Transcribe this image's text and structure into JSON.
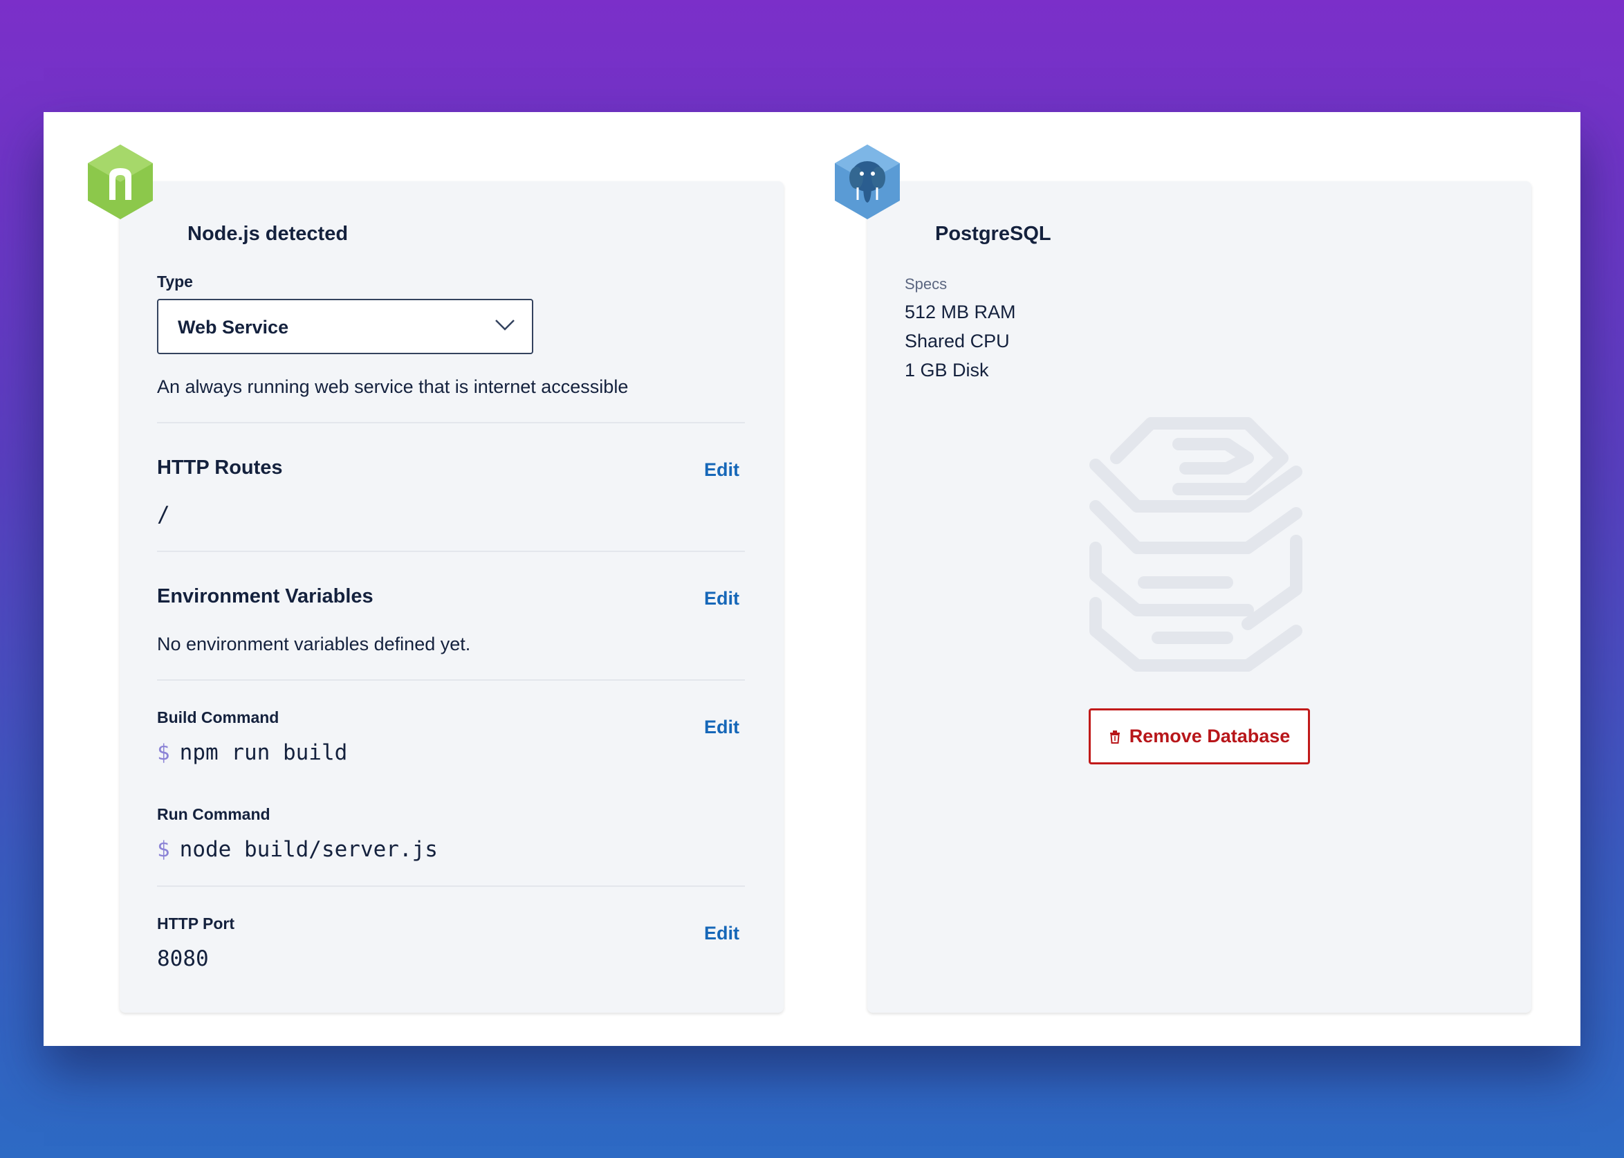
{
  "service": {
    "title": "Node.js detected",
    "type_label": "Type",
    "type_value": "Web Service",
    "type_description": "An always running web service that is internet accessible",
    "http_routes": {
      "title": "HTTP Routes",
      "edit": "Edit",
      "value": "/"
    },
    "env_vars": {
      "title": "Environment Variables",
      "edit": "Edit",
      "value": "No environment variables defined yet."
    },
    "build_command": {
      "label": "Build Command",
      "edit": "Edit",
      "prompt": "$",
      "value": "npm run build"
    },
    "run_command": {
      "label": "Run Command",
      "prompt": "$",
      "value": "node build/server.js"
    },
    "http_port": {
      "label": "HTTP Port",
      "edit": "Edit",
      "value": "8080"
    },
    "icon": "nodejs-icon",
    "icon_color": "#8cc84b"
  },
  "database": {
    "title": "PostgreSQL",
    "specs_label": "Specs",
    "specs": [
      "512 MB RAM",
      "Shared CPU",
      "1 GB Disk"
    ],
    "remove_button": "Remove Database",
    "icon": "postgresql-icon",
    "icon_color": "#336791",
    "remove_color": "#c11a1a"
  },
  "colors": {
    "link": "#1667b8",
    "background_top": "#7b2fc9",
    "background_bottom": "#2d6ac4"
  }
}
